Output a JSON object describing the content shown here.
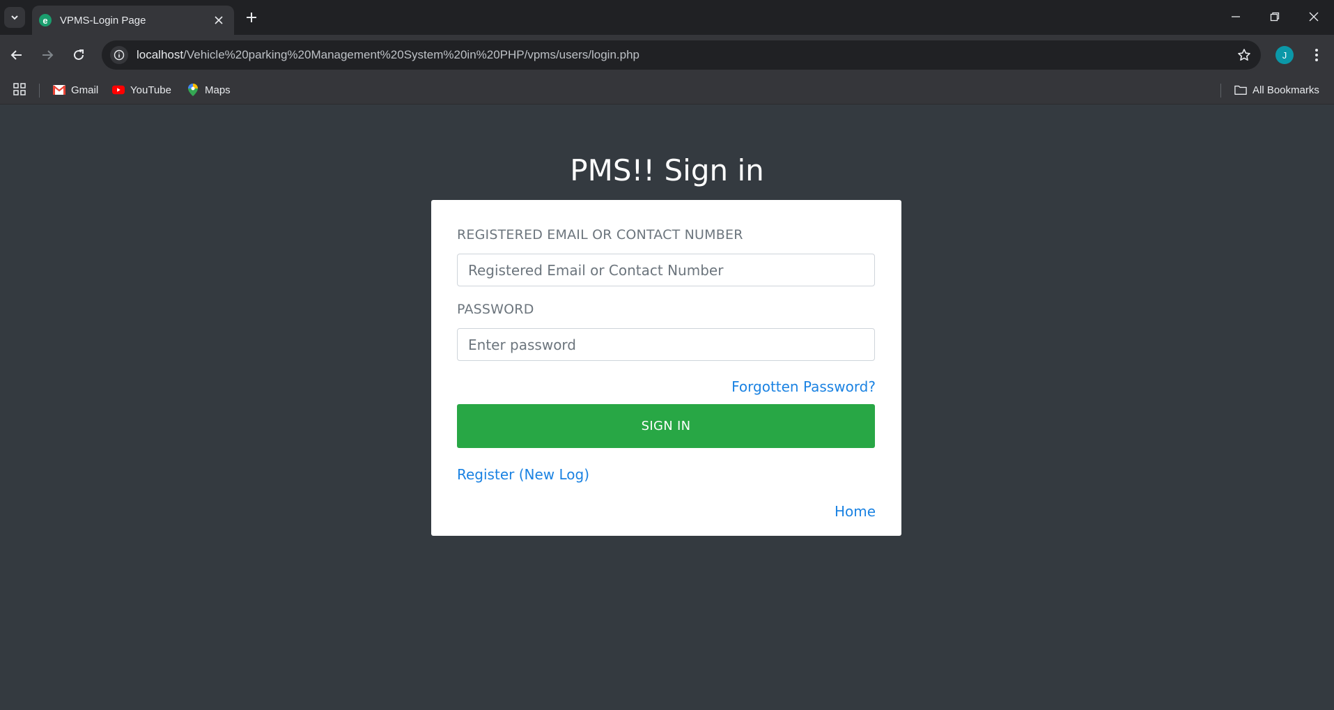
{
  "browser": {
    "tab_title": "VPMS-Login Page",
    "favicon_letter": "e",
    "url_host": "localhost",
    "url_path": "/Vehicle%20parking%20Management%20System%20in%20PHP/vpms/users/login.php",
    "avatar_letter": "J",
    "bookmarks": [
      {
        "label": "Gmail",
        "icon": "gmail-icon"
      },
      {
        "label": "YouTube",
        "icon": "youtube-icon"
      },
      {
        "label": "Maps",
        "icon": "maps-icon"
      }
    ],
    "all_bookmarks_label": "All Bookmarks"
  },
  "login": {
    "title": "PMS!! Sign in",
    "email_label": "REGISTERED EMAIL OR CONTACT NUMBER",
    "email_placeholder": "Registered Email or Contact Number",
    "email_value": "",
    "password_label": "PASSWORD",
    "password_placeholder": "Enter password",
    "password_value": "",
    "forgot_link": "Forgotten Password?",
    "signin_button": "SIGN IN",
    "register_link": "Register (New Log)",
    "home_link": "Home"
  },
  "colors": {
    "page_bg": "#343a40",
    "button_green": "#28a745",
    "link_blue": "#1a82e2"
  }
}
